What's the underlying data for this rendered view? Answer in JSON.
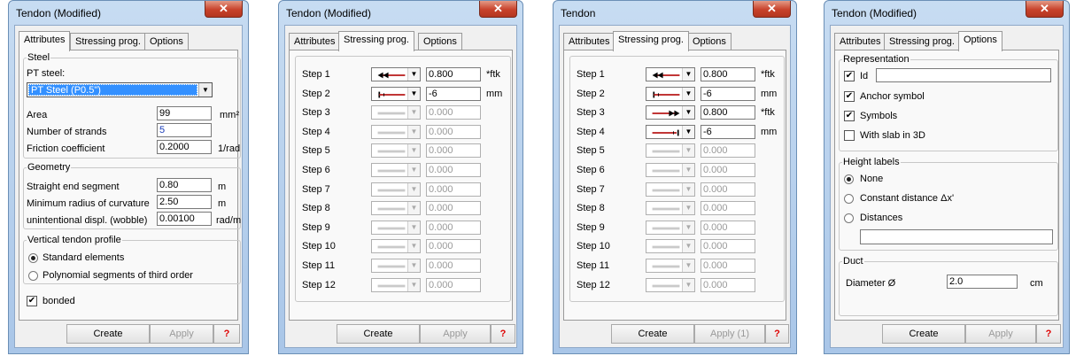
{
  "colors": {
    "title_bg": "#bcd4ee",
    "close": "#c8422b",
    "selection": "#3390ff",
    "arrow_red": "#b81a1a"
  },
  "tabs": {
    "attributes": "Attributes",
    "stressing": "Stressing prog.",
    "options": "Options"
  },
  "buttons": {
    "create": "Create",
    "apply": "Apply",
    "apply_count": "Apply (1)",
    "help": "?"
  },
  "close_icon": "✕",
  "dialog1": {
    "title": "Tendon (Modified)",
    "steel": {
      "legend": "Steel",
      "pt_label": "PT steel:",
      "pt_value": "PT Steel (P0.5\")",
      "area_label": "Area",
      "area_value": "99",
      "area_unit": "mm²",
      "strands_label": "Number of strands",
      "strands_value": "5",
      "friction_label": "Friction coefficient",
      "friction_value": "0.2000",
      "friction_unit": "1/rad"
    },
    "geometry": {
      "legend": "Geometry",
      "straight_label": "Straight end segment",
      "straight_value": "0.80",
      "straight_unit": "m",
      "radius_label": "Minimum radius of curvature",
      "radius_value": "2.50",
      "radius_unit": "m",
      "wobble_label": "unintentional displ. (wobble)",
      "wobble_value": "0.00100",
      "wobble_unit": "rad/m"
    },
    "profile": {
      "legend": "Vertical tendon profile",
      "opt1": "Standard elements",
      "opt2": "Polynomial segments of third order"
    },
    "bonded_label": "bonded"
  },
  "dialog2": {
    "title": "Tendon (Modified)",
    "steps": [
      {
        "label": "Step 1",
        "icon": "double-left-arrow-icon",
        "value": "0.800",
        "unit": "*ftk",
        "active": true
      },
      {
        "label": "Step 2",
        "icon": "anchor-bar-icon",
        "value": "-6",
        "unit": "mm",
        "active": true
      },
      {
        "label": "Step 3",
        "icon": "empty-line-icon",
        "value": "0.000",
        "unit": "",
        "active": false
      },
      {
        "label": "Step 4",
        "icon": "empty-line-icon",
        "value": "0.000",
        "unit": "",
        "active": false
      },
      {
        "label": "Step 5",
        "icon": "empty-line-icon",
        "value": "0.000",
        "unit": "",
        "active": false
      },
      {
        "label": "Step 6",
        "icon": "empty-line-icon",
        "value": "0.000",
        "unit": "",
        "active": false
      },
      {
        "label": "Step 7",
        "icon": "empty-line-icon",
        "value": "0.000",
        "unit": "",
        "active": false
      },
      {
        "label": "Step 8",
        "icon": "empty-line-icon",
        "value": "0.000",
        "unit": "",
        "active": false
      },
      {
        "label": "Step 9",
        "icon": "empty-line-icon",
        "value": "0.000",
        "unit": "",
        "active": false
      },
      {
        "label": "Step 10",
        "icon": "empty-line-icon",
        "value": "0.000",
        "unit": "",
        "active": false
      },
      {
        "label": "Step 11",
        "icon": "empty-line-icon",
        "value": "0.000",
        "unit": "",
        "active": false
      },
      {
        "label": "Step 12",
        "icon": "empty-line-icon",
        "value": "0.000",
        "unit": "",
        "active": false
      }
    ]
  },
  "dialog3": {
    "title": "Tendon",
    "steps": [
      {
        "label": "Step 1",
        "icon": "double-left-arrow-icon",
        "value": "0.800",
        "unit": "*ftk",
        "active": true
      },
      {
        "label": "Step 2",
        "icon": "anchor-bar-icon",
        "value": "-6",
        "unit": "mm",
        "active": true
      },
      {
        "label": "Step 3",
        "icon": "double-right-arrow-icon",
        "value": "0.800",
        "unit": "*ftk",
        "active": true
      },
      {
        "label": "Step 4",
        "icon": "anchor-bar-right-icon",
        "value": "-6",
        "unit": "mm",
        "active": true
      },
      {
        "label": "Step 5",
        "icon": "empty-line-icon",
        "value": "0.000",
        "unit": "",
        "active": false
      },
      {
        "label": "Step 6",
        "icon": "empty-line-icon",
        "value": "0.000",
        "unit": "",
        "active": false
      },
      {
        "label": "Step 7",
        "icon": "empty-line-icon",
        "value": "0.000",
        "unit": "",
        "active": false
      },
      {
        "label": "Step 8",
        "icon": "empty-line-icon",
        "value": "0.000",
        "unit": "",
        "active": false
      },
      {
        "label": "Step 9",
        "icon": "empty-line-icon",
        "value": "0.000",
        "unit": "",
        "active": false
      },
      {
        "label": "Step 10",
        "icon": "empty-line-icon",
        "value": "0.000",
        "unit": "",
        "active": false
      },
      {
        "label": "Step 11",
        "icon": "empty-line-icon",
        "value": "0.000",
        "unit": "",
        "active": false
      },
      {
        "label": "Step 12",
        "icon": "empty-line-icon",
        "value": "0.000",
        "unit": "",
        "active": false
      }
    ]
  },
  "dialog4": {
    "title": "Tendon (Modified)",
    "representation": {
      "legend": "Representation",
      "id_label": "Id",
      "id_value": "",
      "anchor_label": "Anchor symbol",
      "symbols_label": "Symbols",
      "slab3d_label": "With slab in 3D"
    },
    "height": {
      "legend": "Height labels",
      "none_label": "None",
      "const_label": "Constant distance Δx'",
      "dist_label": "Distances",
      "dist_value": ""
    },
    "duct": {
      "legend": "Duct",
      "diameter_label": "Diameter Ø",
      "diameter_value": "2.0",
      "diameter_unit": "cm"
    }
  }
}
